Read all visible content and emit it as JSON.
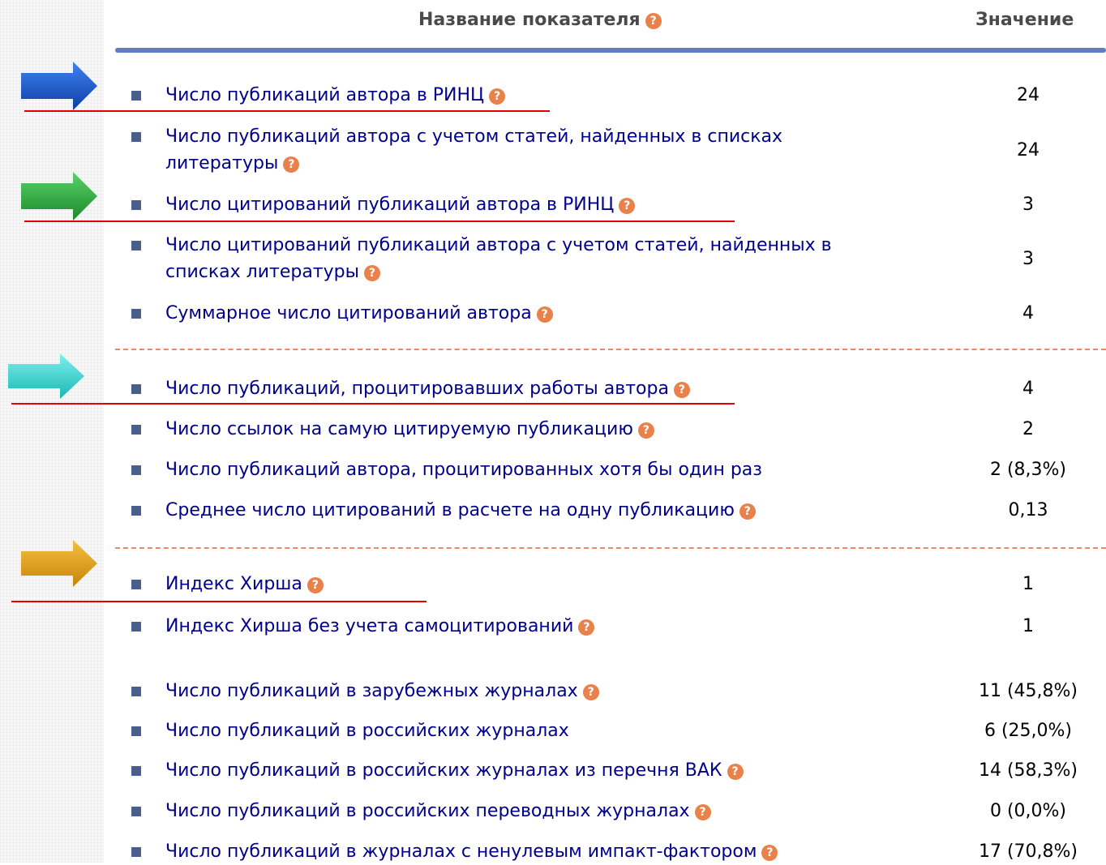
{
  "header": {
    "name_label": "Название показателя",
    "value_label": "Значение"
  },
  "icons": {
    "help": "question-mark-circle-icon",
    "bullet": "square-bullet-icon",
    "arrow": "arrow-right-icon"
  },
  "colors": {
    "link": "#00008b",
    "help": "#e8824a",
    "header_rule": "#5c7fc6",
    "separator": "#e8896a",
    "highlight_underline": "#e40000",
    "arrow_blue": "#1a55c8",
    "arrow_green": "#28a83a",
    "arrow_cyan": "#2ed4d0",
    "arrow_orange": "#e6a21a"
  },
  "rows": [
    {
      "label": "Число публикаций автора в РИНЦ",
      "value": "24"
    },
    {
      "label": "Число публикаций автора с учетом статей, найденных в списках литературы",
      "value": "24"
    },
    {
      "label": "Число цитирований публикаций автора в РИНЦ",
      "value": "3"
    },
    {
      "label": "Число цитирований публикаций автора с учетом статей, найденных в списках литературы",
      "value": "3"
    },
    {
      "label": "Суммарное число цитирований автора",
      "value": "4"
    },
    {
      "label": "Число публикаций, процитировавших работы автора",
      "value": "4"
    },
    {
      "label": "Число ссылок на самую цитируемую публикацию",
      "value": "2"
    },
    {
      "label": "Число публикаций автора, процитированных хотя бы один раз",
      "value": "2 (8,3%)"
    },
    {
      "label": "Среднее число цитирований в расчете на одну публикацию",
      "value": "0,13"
    },
    {
      "label": "Индекс Хирша",
      "value": "1"
    },
    {
      "label": "Индекс Хирша без учета самоцитирований",
      "value": "1"
    },
    {
      "label": "Число публикаций в зарубежных журналах",
      "value": "11 (45,8%)"
    },
    {
      "label": "Число публикаций в российских журналах",
      "value": "6 (25,0%)"
    },
    {
      "label": "Число публикаций в российских журналах из перечня ВАК",
      "value": "14 (58,3%)"
    },
    {
      "label": "Число публикаций в российских переводных журналах",
      "value": "0 (0,0%)"
    },
    {
      "label": "Число публикаций в журналах с ненулевым импакт-фактором",
      "value": "17 (70,8%)"
    }
  ]
}
